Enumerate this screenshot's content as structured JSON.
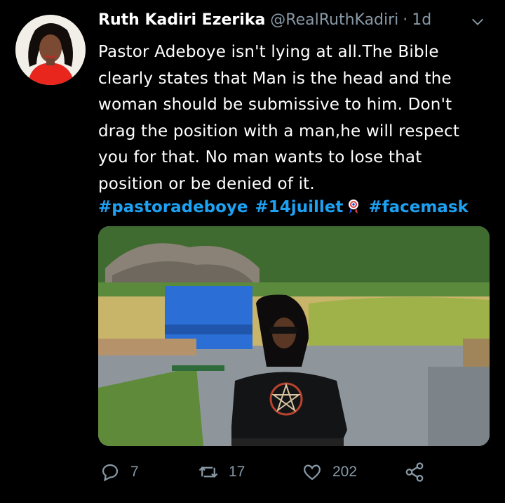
{
  "author": {
    "name": "Ruth Kadiri Ezerika",
    "handle": "@RealRuthKadiri",
    "separator": "·",
    "time": "1d"
  },
  "tweet": {
    "lines": [
      "Pastor Adeboye isn't lying at all.The Bible",
      "clearly states that Man is the head and the",
      "woman should be submissive to him. Don't",
      "drag the position with a man,he will respect",
      "you for that. No man wants to lose that",
      "position or be denied of it."
    ],
    "hashtags": [
      "#pastoradeboye",
      "#14juillet",
      "#facemask"
    ]
  },
  "actions": {
    "replies": "7",
    "retweets": "17",
    "likes": "202"
  },
  "colors": {
    "link": "#1da1f2",
    "muted": "#8899a6",
    "background": "#000000"
  },
  "icons": [
    "chevron-down-icon",
    "reply-icon",
    "retweet-icon",
    "like-icon",
    "share-icon",
    "rosette-icon"
  ]
}
